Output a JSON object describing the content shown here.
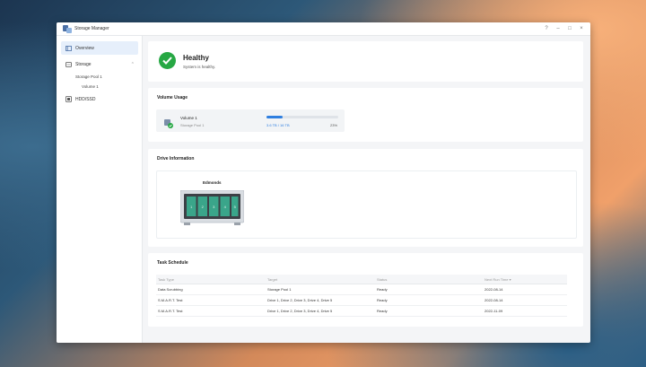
{
  "window": {
    "title": "Storage Manager",
    "controls": [
      "?",
      "–",
      "□",
      "×"
    ]
  },
  "sidebar": {
    "overview": "Overview",
    "storage": "Storage",
    "storage_pool": "Storage Pool 1",
    "volume": "Volume 1",
    "hdd": "HDD/SSD"
  },
  "health": {
    "status": "Healthy",
    "message": "System is healthy."
  },
  "volume_usage": {
    "title": "Volume Usage",
    "volume_name": "Volume 1",
    "pool_name": "Storage Pool 1",
    "capacity": "3.6 TB / 16 TB",
    "percent": "23%",
    "fill": 0.23
  },
  "drive_info": {
    "title": "Drive Information",
    "device_name": "Edmonds"
  },
  "task_schedule": {
    "title": "Task Schedule",
    "columns": [
      "Task Type",
      "Target",
      "Status",
      "Next Run Time ▾"
    ],
    "rows": [
      [
        "Data Scrubbing",
        "Storage Pool 1",
        "Ready",
        "2022-08-14"
      ],
      [
        "S.M.A.R.T. Test",
        "Drive 1, Drive 2, Drive 3, Drive 4, Drive 5",
        "Ready",
        "2022-08-14"
      ],
      [
        "S.M.A.R.T. Test",
        "Drive 1, Drive 2, Drive 3, Drive 4, Drive 5",
        "Ready",
        "2022-11-09"
      ]
    ]
  },
  "colors": {
    "accent": "#2f7fe0",
    "success": "#27a844",
    "nav_active": "#e6effb"
  }
}
